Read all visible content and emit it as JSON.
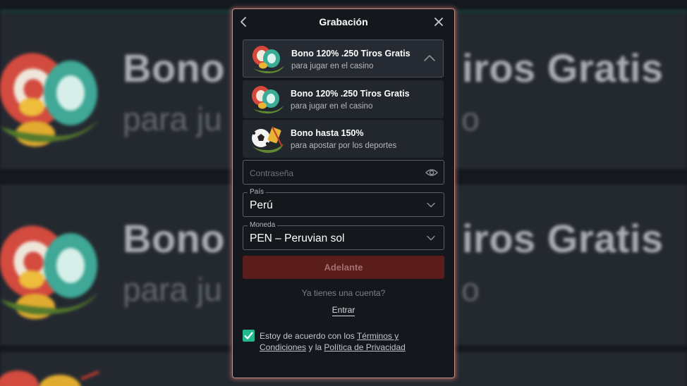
{
  "background": {
    "title_left": "Bono",
    "title_right": "iros Gratis",
    "sub_left": "para ju",
    "sub_right": "o"
  },
  "modal": {
    "title": "Grabación",
    "back_icon": "chevron-left-icon",
    "close_icon": "close-icon"
  },
  "offers": [
    {
      "title": "Bono 120% .250 Tiros Gratis",
      "subtitle": "para jugar en el casino",
      "icon": "casino-chips-icon",
      "selected": true
    },
    {
      "title": "Bono 120% .250 Tiros Gratis",
      "subtitle": "para jugar en el casino",
      "icon": "casino-chips-icon",
      "selected": false
    },
    {
      "title": "Bono hasta 150%",
      "subtitle": "para apostar por los deportes",
      "icon": "soccer-ball-icon",
      "selected": false
    }
  ],
  "form": {
    "password_placeholder": "Contraseña",
    "country_label": "País",
    "country_value": "Perú",
    "currency_label": "Moneda",
    "currency_value": "PEN – Peruvian sol",
    "submit_label": "Adelante",
    "have_account_text": "Ya tienes una cuenta?",
    "login_label": "Entrar"
  },
  "terms": {
    "checked": true,
    "prefix": "Estoy de acuerdo con los ",
    "terms_link": "Términos y Condiciones",
    "middle": " y la ",
    "privacy_link": "Política de Privacidad"
  },
  "colors": {
    "accent_green": "#22b88f",
    "submit_bg": "#5a1d1b",
    "modal_bg": "#14171c",
    "modal_glow": "#c98b86"
  }
}
